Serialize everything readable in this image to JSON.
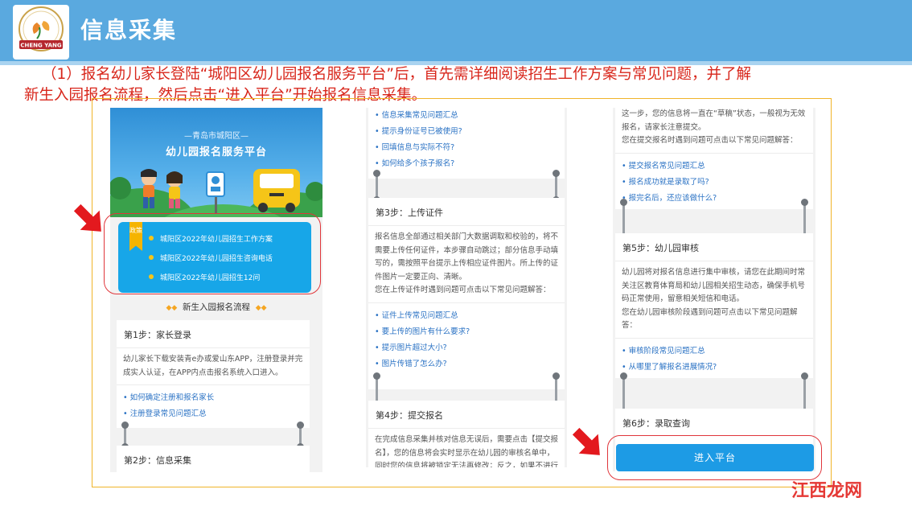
{
  "header": {
    "title": "信息采集",
    "logo_text": "CHENG YANG"
  },
  "intro": {
    "line1": "（1）报名幼儿家长登陆“城阳区幼儿园报名服务平台”后，首先需详细阅读招生工作方案与常见问题，并了解",
    "line2": "新生入园报名流程，然后点击“进入平台”开始报名信息采集。"
  },
  "col1": {
    "banner_sub": "—青岛市城阳区—",
    "banner_title": "幼儿园报名服务平台",
    "policy_badge": "政策",
    "policy_items": [
      "城阳区2022年幼儿园招生工作方案",
      "城阳区2022年幼儿园招生咨询电话",
      "城阳区2022年幼儿园招生12问"
    ],
    "flow_heading": "新生入园报名流程",
    "step1": {
      "title": "第1步：家长登录",
      "body": "幼儿家长下载安装青e办或爱山东APP，注册登录并完成实人认证，在APP内点击报名系统入口进入。",
      "links": [
        "如何确定注册和报名家长",
        "注册登录常见问题汇总"
      ]
    },
    "step2": {
      "title": "第2步：信息采集"
    }
  },
  "col2": {
    "top_links": [
      "信息采集常见问题汇总",
      "提示身份证号已被使用?",
      "回填信息与实际不符?",
      "如何给多个孩子报名?"
    ],
    "step3": {
      "title": "第3步：上传证件",
      "body": "报名信息全部通过相关部门大数据调取和校验的，将不需要上传任何证件，本步骤自动跳过；部分信息手动填写的，需按照平台提示上传相应证件图片。所上传的证件图片一定要正向、清晰。",
      "body2": "您在上传证件时遇到问题可点击以下常见问题解答：",
      "links": [
        "证件上传常见问题汇总",
        "要上传的图片有什么要求?",
        "提示图片超过大小?",
        "图片传错了怎么办?"
      ]
    },
    "step4": {
      "title": "第4步：提交报名",
      "body": "在完成信息采集并核对信息无误后，需要点击【提交报名】，您的信息将会实时显示在幼儿园的审核名单中，同时您的信息将被锁定无法再修改；反之，如果不进行"
    }
  },
  "col3": {
    "top_body": "这一步，您的信息将一直在“草稿”状态，一般视为无效报名，请家长注意提交。",
    "top_body2": "您在提交报名时遇到问题可点击以下常见问题解答：",
    "top_links": [
      "提交报名常见问题汇总",
      "报名成功就是录取了吗?",
      "报完名后，还应该做什么?"
    ],
    "step5": {
      "title": "第5步：幼儿园审核",
      "body": "幼儿园将对报名信息进行集中审核，请您在此期间时常关注区教育体育局和幼儿园相关招生动态，确保手机号码正常使用，留意相关短信和电话。",
      "body2": "您在幼儿园审核阶段遇到问题可点击以下常见问题解答：",
      "links": [
        "审核阶段常见问题汇总",
        "从哪里了解报名进展情况?"
      ]
    },
    "step6": {
      "title": "第6步：录取查询"
    },
    "enter_button": "进入平台"
  },
  "watermark": "江西龙网",
  "colors": {
    "header_bg": "#5aa9df",
    "intro_text": "#d8261b",
    "frame_border": "#f0b429",
    "link": "#2a72c4",
    "policy_bg": "#17a6e8",
    "button_bg": "#1d9be5",
    "highlight_red": "#e0363b"
  }
}
